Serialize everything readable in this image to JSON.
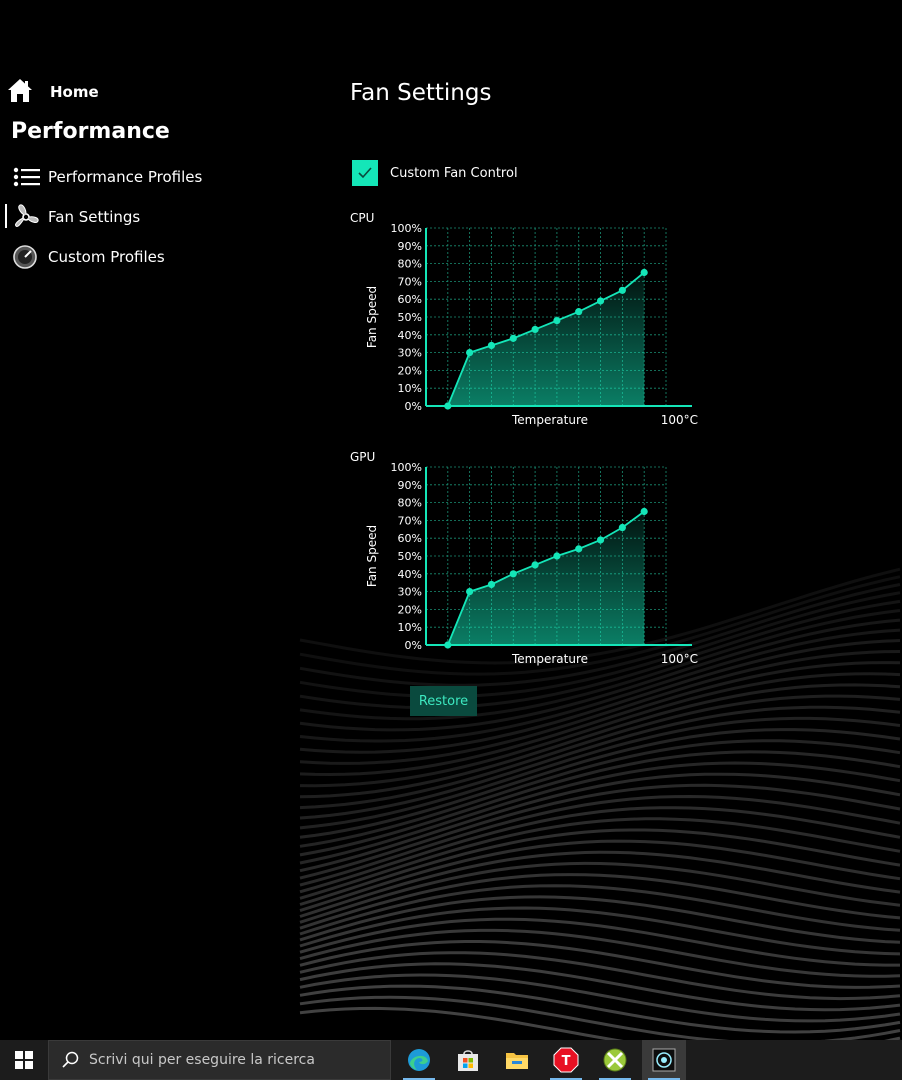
{
  "sidebar": {
    "home_label": "Home",
    "section_title": "Performance",
    "items": [
      {
        "label": "Performance Profiles",
        "icon": "list-icon"
      },
      {
        "label": "Fan Settings",
        "icon": "fan-icon",
        "selected": true
      },
      {
        "label": "Custom Profiles",
        "icon": "gauge-icon"
      }
    ]
  },
  "main": {
    "title": "Fan Settings",
    "custom_fan_control": {
      "label": "Custom Fan Control",
      "checked": true
    },
    "restore_label": "Restore"
  },
  "chart_data": [
    {
      "type": "area",
      "title": "CPU",
      "xlabel": "Temperature",
      "ylabel": "Fan Speed",
      "x_end_label": "100°C",
      "y_ticks": [
        "0%",
        "10%",
        "20%",
        "30%",
        "40%",
        "50%",
        "60%",
        "70%",
        "80%",
        "90%",
        "100%"
      ],
      "ylim": [
        0,
        100
      ],
      "x": [
        1,
        2,
        3,
        4,
        5,
        6,
        7,
        8,
        9,
        10
      ],
      "values": [
        0,
        30,
        34,
        38,
        43,
        48,
        53,
        59,
        65,
        75
      ],
      "grid": true,
      "accent": "#14e6b8"
    },
    {
      "type": "area",
      "title": "GPU",
      "xlabel": "Temperature",
      "ylabel": "Fan Speed",
      "x_end_label": "100°C",
      "y_ticks": [
        "0%",
        "10%",
        "20%",
        "30%",
        "40%",
        "50%",
        "60%",
        "70%",
        "80%",
        "90%",
        "100%"
      ],
      "ylim": [
        0,
        100
      ],
      "x": [
        1,
        2,
        3,
        4,
        5,
        6,
        7,
        8,
        9,
        10
      ],
      "values": [
        0,
        30,
        34,
        40,
        45,
        50,
        54,
        59,
        66,
        75
      ],
      "grid": true,
      "accent": "#14e6b8"
    }
  ],
  "taskbar": {
    "search_placeholder": "Scrivi qui per eseguire la ricerca",
    "apps": [
      {
        "icon": "edge-icon",
        "running": true
      },
      {
        "icon": "store-icon",
        "running": false
      },
      {
        "icon": "file-explorer-icon",
        "running": false
      },
      {
        "icon": "t-app-icon",
        "running": true
      },
      {
        "icon": "xbox-game-bar-icon",
        "running": true
      },
      {
        "icon": "fan-control-app-icon",
        "running": true,
        "active": true
      }
    ]
  },
  "colors": {
    "accent": "#14e6b8",
    "restore_bg": "#0a4a3e",
    "taskbar_bg": "#1c1c1c"
  }
}
